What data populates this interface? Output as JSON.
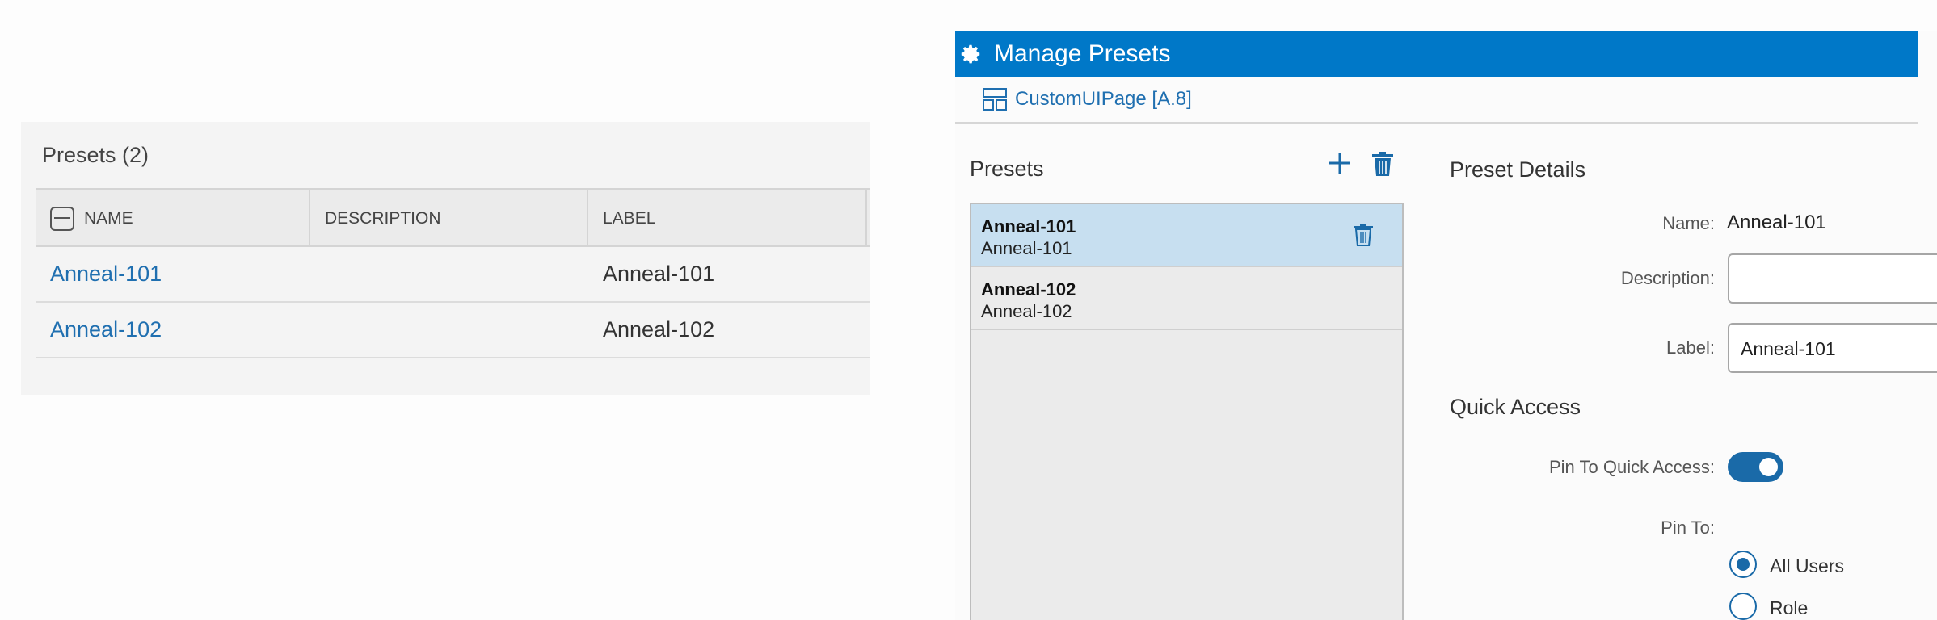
{
  "table_panel": {
    "title": "Presets (2)",
    "columns": [
      "NAME",
      "DESCRIPTION",
      "LABEL"
    ],
    "rows": [
      {
        "name": "Anneal-101",
        "description": "",
        "label": "Anneal-101"
      },
      {
        "name": "Anneal-102",
        "description": "",
        "label": "Anneal-102"
      }
    ]
  },
  "dialog": {
    "title": "Manage Presets",
    "breadcrumb": "CustomUIPage [A.8]",
    "list_title": "Presets",
    "presets": [
      {
        "name": "Anneal-101",
        "label": "Anneal-101",
        "selected": true
      },
      {
        "name": "Anneal-102",
        "label": "Anneal-102",
        "selected": false
      }
    ],
    "details": {
      "title": "Preset Details",
      "name_label": "Name:",
      "name_value": "Anneal-101",
      "description_label": "Description:",
      "description_value": "",
      "label_label": "Label:",
      "label_value": "Anneal-101"
    },
    "quick_access": {
      "title": "Quick Access",
      "pin_label": "Pin To Quick Access:",
      "pin_enabled": true,
      "pin_to_label": "Pin To:",
      "options": [
        "All Users",
        "Role"
      ],
      "selected_option": "All Users"
    }
  },
  "colors": {
    "accent": "#0078c8",
    "link": "#1f6fb0",
    "selected_row": "#c7dff0",
    "toggle_on": "#1a6aa8"
  },
  "icons": {
    "table_header": "minus-square-icon",
    "titlebar": "gear-icon",
    "breadcrumb": "page-layout-icon",
    "add": "plus-icon",
    "delete": "trash-icon"
  }
}
